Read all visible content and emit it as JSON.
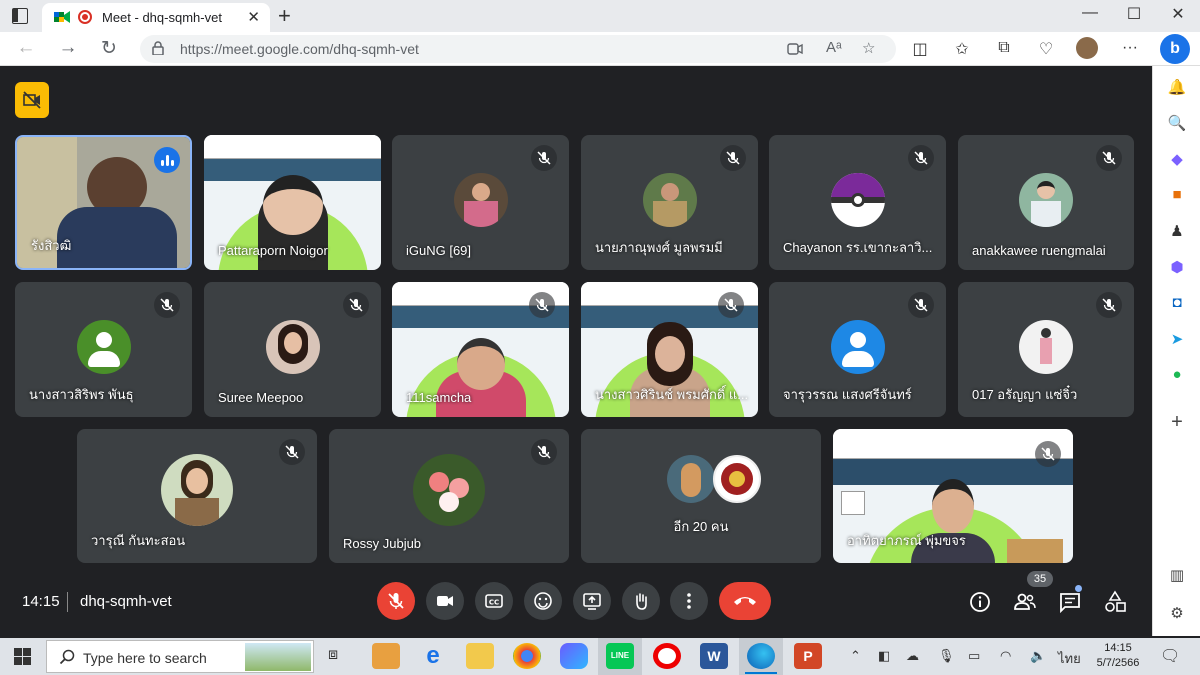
{
  "browser": {
    "tab_title": "Meet - dhq-sqmh-vet",
    "tab_close": "✕",
    "new_tab": "+",
    "url": "https://meet.google.com/dhq-sqmh-vet",
    "controls": {
      "minimize": "—",
      "maximize": "☐",
      "close": "✕"
    }
  },
  "participants": [
    {
      "name": "รังสิวฒิ",
      "speaking": true
    },
    {
      "name": "Pattaraporn Noigor"
    },
    {
      "name": "iGuNG [69]"
    },
    {
      "name": "นายภาณุพงศ์ มูลพรมมี"
    },
    {
      "name": "Chayanon รร.เขากะลาวิ..."
    },
    {
      "name": "anakkawee ruengmalai"
    },
    {
      "name": "นางสาวสิริพร พันธุ"
    },
    {
      "name": "Suree Meepoo"
    },
    {
      "name": "111samcha"
    },
    {
      "name": "นางสาวศิรินช์ พรมศักดิ์ แ..."
    },
    {
      "name": "จารุวรรณ แสงศรีจันทร์"
    },
    {
      "name": "017 อรัญญา แซ่จิ๋ว"
    },
    {
      "name": "วารุณี กันทะสอน"
    },
    {
      "name": "Rossy Jubjub"
    },
    {
      "name": "อีก 20 คน"
    },
    {
      "name": "อาทิตยาภรณ์ พุ่มขจร"
    }
  ],
  "meeting": {
    "time": "14:15",
    "code": "dhq-sqmh-vet",
    "participant_count": "35"
  },
  "taskbar": {
    "search_placeholder": "Type here to search",
    "clock_time": "14:15",
    "clock_date": "5/7/2566",
    "language": "ไทย"
  },
  "colors": {
    "meet_bg": "#202124",
    "tile_bg": "#3c4043",
    "hangup_red": "#ea4335",
    "speaking_blue": "#8ab4f8",
    "slide_green": "#a6e65a"
  }
}
